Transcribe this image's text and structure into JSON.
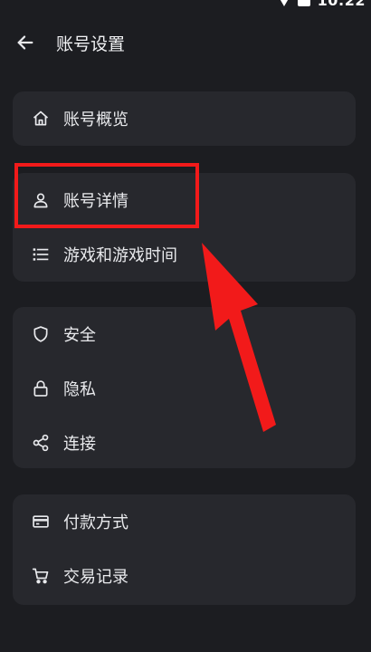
{
  "status_bar": {
    "time": "10:22"
  },
  "header": {
    "title": "账号设置"
  },
  "groups": [
    {
      "items": [
        {
          "label": "账号概览",
          "icon": "home-icon"
        }
      ]
    },
    {
      "items": [
        {
          "label": "账号详情",
          "icon": "person-icon"
        },
        {
          "label": "游戏和游戏时间",
          "icon": "list-icon"
        }
      ]
    },
    {
      "items": [
        {
          "label": "安全",
          "icon": "shield-icon"
        },
        {
          "label": "隐私",
          "icon": "lock-icon"
        },
        {
          "label": "连接",
          "icon": "share-icon"
        }
      ]
    },
    {
      "items": [
        {
          "label": "付款方式",
          "icon": "credit-card-icon"
        },
        {
          "label": "交易记录",
          "icon": "cart-icon"
        }
      ]
    }
  ],
  "colors": {
    "background": "#1c1d21",
    "card": "#27282d",
    "text": "#e9eaed",
    "annotation": "#f21a1a"
  }
}
